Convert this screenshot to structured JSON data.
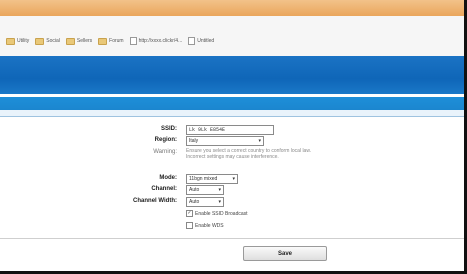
{
  "browser": {
    "bookmarks": [
      {
        "label": "Utility",
        "icon": "folder-icon"
      },
      {
        "label": "Social",
        "icon": "folder-icon"
      },
      {
        "label": "Sellers",
        "icon": "folder-icon"
      },
      {
        "label": "Forum",
        "icon": "folder-icon"
      },
      {
        "label": "http://xxxx.clickr/4...",
        "icon": "page-icon"
      },
      {
        "label": "Untitled",
        "icon": "page-icon"
      }
    ]
  },
  "form": {
    "ssid": {
      "label": "SSID:",
      "value": "Lk 9Lk E854E"
    },
    "region": {
      "label": "Region:",
      "value": "Italy"
    },
    "warning": {
      "label": "Warning:",
      "text": "Ensure you select a correct country to conform local law. Incorrect settings may cause interference."
    },
    "mode": {
      "label": "Mode:",
      "value": "11bgn mixed"
    },
    "channel": {
      "label": "Channel:",
      "value": "Auto"
    },
    "channel_width": {
      "label": "Channel Width:",
      "value": "Auto"
    },
    "ssid_broadcast": {
      "label": "Enable SSID Broadcast",
      "checked": true
    },
    "wds": {
      "label": "Enable WDS",
      "checked": false
    }
  },
  "actions": {
    "save_label": "Save"
  },
  "colors": {
    "title_strip": "#eaa65c",
    "header": "#0f66b8",
    "sub_band": "#1b86cf"
  }
}
